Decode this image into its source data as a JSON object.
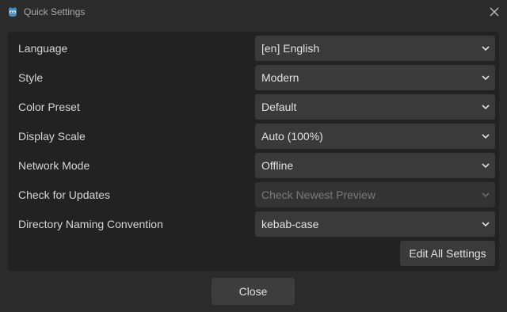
{
  "window": {
    "title": "Quick Settings",
    "app_icon": "godot-logo-icon",
    "close_icon": "close-icon"
  },
  "settings": [
    {
      "label": "Language",
      "value": "[en] English",
      "disabled": false
    },
    {
      "label": "Style",
      "value": "Modern",
      "disabled": false
    },
    {
      "label": "Color Preset",
      "value": "Default",
      "disabled": false
    },
    {
      "label": "Display Scale",
      "value": "Auto (100%)",
      "disabled": false
    },
    {
      "label": "Network Mode",
      "value": "Offline",
      "disabled": false
    },
    {
      "label": "Check for Updates",
      "value": "Check Newest Preview",
      "disabled": true
    },
    {
      "label": "Directory Naming Convention",
      "value": "kebab-case",
      "disabled": false
    }
  ],
  "buttons": {
    "edit_all": "Edit All Settings",
    "close": "Close"
  },
  "colors": {
    "window_bg": "#2b2b2b",
    "panel_bg": "#222222",
    "control_bg": "#3a3a3a",
    "text": "#dcdcdc",
    "disabled_text": "#7a7a7a",
    "logo": "#478cbf"
  }
}
